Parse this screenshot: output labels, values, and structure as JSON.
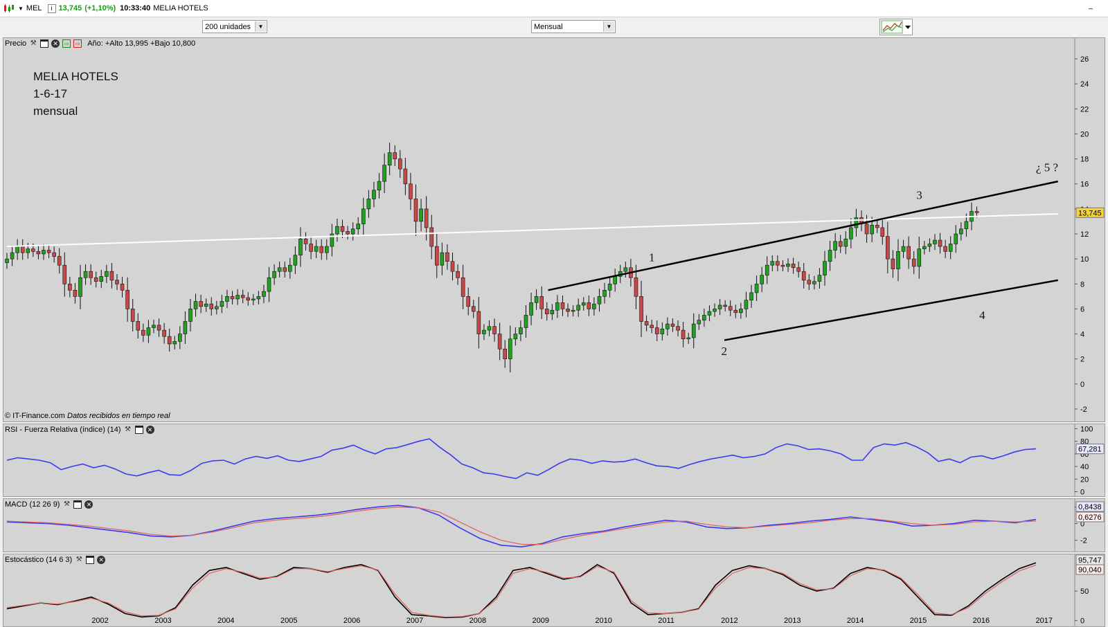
{
  "titlebar": {
    "symbol": "MEL",
    "price": "13,745",
    "change": "(+1,10%)",
    "time": "10:33:40",
    "name": "MELIA HOTELS",
    "minimize": "_"
  },
  "toolbar": {
    "units_value": "200 unidades",
    "period_value": "Mensual"
  },
  "price_panel": {
    "label": "Precio",
    "year_info": "Año: +Alto 13,995 +Bajo 10,800",
    "annotation": [
      "MELIA HOTELS",
      "1-6-17",
      "mensual"
    ],
    "copyright": "© IT-Finance.com",
    "realtime": "Datos recibidos en tiempo real",
    "last_price_badge": "13,745",
    "wave_labels": [
      "1",
      "2",
      "3",
      "4",
      "¿ 5 ?"
    ]
  },
  "rsi_panel": {
    "label": "RSI - Fuerza Relativa (índice) (14)",
    "value_badge": "67,281"
  },
  "macd_panel": {
    "label": "MACD (12 26 9)",
    "value_badge_1": "0,8438",
    "value_badge_2": "0,6276"
  },
  "stoch_panel": {
    "label": "Estocástico (14 6 3)",
    "value_badge_1": "95,747",
    "value_badge_2": "90,040"
  },
  "colors": {
    "up": "#22a022",
    "down": "#c84848",
    "rsi": "#3a3aee",
    "macd": "#3a3aee",
    "signal": "#e06060"
  },
  "chart_data": [
    {
      "type": "candlestick",
      "title": "MELIA HOTELS",
      "x_ticks": [
        "2002",
        "2003",
        "2004",
        "2005",
        "2006",
        "2007",
        "2008",
        "2009",
        "2010",
        "2011",
        "2012",
        "2013",
        "2014",
        "2015",
        "2016",
        "2017"
      ],
      "y_ticks": [
        -2,
        0,
        2,
        4,
        6,
        8,
        10,
        12,
        14,
        16,
        18,
        20,
        22,
        24,
        26
      ],
      "ylim": [
        -3,
        27
      ],
      "start": 2001.0,
      "step": 0.0833,
      "close": [
        10.0,
        10.5,
        11.0,
        10.5,
        10.8,
        10.6,
        10.4,
        10.7,
        10.5,
        10.2,
        9.5,
        8.0,
        7.5,
        7.0,
        8.5,
        9.0,
        8.5,
        8.2,
        8.6,
        9.0,
        8.3,
        8.0,
        7.5,
        6.0,
        5.0,
        4.3,
        3.9,
        4.5,
        4.7,
        4.3,
        3.8,
        3.2,
        3.4,
        4.0,
        5.0,
        6.0,
        6.6,
        6.2,
        6.4,
        6.0,
        6.2,
        6.6,
        7.0,
        6.8,
        7.1,
        6.9,
        6.7,
        6.8,
        7.0,
        7.4,
        8.5,
        9.0,
        9.3,
        9.0,
        9.5,
        10.3,
        11.6,
        11.2,
        10.6,
        11.0,
        10.5,
        11.0,
        12.0,
        12.6,
        12.2,
        12.0,
        12.4,
        12.8,
        14.0,
        14.8,
        15.5,
        16.2,
        17.5,
        18.5,
        18.0,
        17.2,
        16.0,
        14.8,
        13.0,
        14.0,
        12.5,
        11.0,
        9.5,
        10.5,
        9.8,
        9.0,
        8.5,
        7.0,
        6.2,
        5.8,
        4.0,
        4.3,
        4.6,
        4.0,
        2.8,
        2.0,
        3.6,
        4.0,
        4.5,
        5.5,
        6.5,
        7.0,
        6.0,
        5.6,
        5.9,
        6.5,
        6.0,
        5.8,
        5.9,
        6.3,
        6.5,
        6.0,
        6.4,
        7.0,
        7.5,
        8.0,
        8.6,
        9.0,
        9.3,
        8.5,
        7.0,
        5.0,
        4.7,
        4.5,
        4.0,
        4.4,
        4.8,
        4.6,
        4.3,
        3.6,
        3.7,
        4.8,
        5.1,
        5.5,
        5.8,
        6.0,
        6.3,
        6.2,
        5.9,
        5.7,
        6.0,
        6.7,
        7.3,
        8.0,
        8.7,
        9.5,
        9.8,
        9.5,
        9.4,
        9.6,
        9.3,
        9.0,
        8.3,
        8.0,
        8.2,
        8.7,
        9.8,
        10.7,
        11.4,
        11.0,
        11.6,
        12.5,
        13.3,
        12.8,
        12.0,
        12.7,
        12.5,
        11.8,
        10.0,
        9.2,
        10.6,
        11.0,
        10.0,
        9.4,
        10.8,
        11.0,
        11.2,
        11.5,
        11.0,
        10.6,
        11.2,
        12.0,
        12.4,
        13.0,
        13.8,
        13.7
      ],
      "channel_upper": [
        [
          2009.6,
          7.5
        ],
        [
          2017.7,
          16.2
        ]
      ],
      "channel_lower": [
        [
          2012.4,
          3.5
        ],
        [
          2017.7,
          8.3
        ]
      ],
      "horizontal_trend": [
        [
          2001.0,
          11.0
        ],
        [
          2017.7,
          13.6
        ]
      ]
    },
    {
      "type": "line",
      "title": "RSI - Fuerza Relativa (índice) (14)",
      "y_ticks": [
        0,
        20,
        40,
        60,
        80,
        100
      ],
      "ylim": [
        -5,
        105
      ],
      "series": [
        {
          "values": [
            50,
            54,
            52,
            50,
            46,
            35,
            40,
            44,
            38,
            42,
            36,
            28,
            25,
            30,
            34,
            27,
            26,
            34,
            45,
            49,
            50,
            44,
            52,
            56,
            53,
            57,
            50,
            48,
            52,
            56,
            66,
            69,
            74,
            66,
            60,
            68,
            70,
            75,
            80,
            84,
            70,
            58,
            44,
            38,
            30,
            28,
            24,
            21,
            30,
            26,
            35,
            45,
            52,
            50,
            45,
            49,
            47,
            48,
            52,
            46,
            41,
            40,
            37,
            43,
            48,
            52,
            55,
            58,
            54,
            56,
            60,
            70,
            76,
            73,
            67,
            68,
            65,
            60,
            50,
            50,
            70,
            76,
            74,
            78,
            71,
            62,
            48,
            52,
            46,
            55,
            57,
            52,
            57,
            63,
            67,
            68
          ]
        }
      ]
    },
    {
      "type": "line",
      "title": "MACD (12 26 9)",
      "y_ticks": [
        -2,
        0,
        2
      ],
      "ylim": [
        -3.2,
        2.8
      ],
      "series": [
        {
          "values": [
            0.2,
            0.1,
            0.0,
            -0.2,
            -0.5,
            -0.8,
            -1.1,
            -1.5,
            -1.6,
            -1.4,
            -0.9,
            -0.3,
            0.3,
            0.6,
            0.8,
            1.0,
            1.3,
            1.7,
            2.0,
            2.2,
            1.9,
            1.0,
            -0.5,
            -1.8,
            -2.6,
            -2.8,
            -2.4,
            -1.6,
            -1.2,
            -0.9,
            -0.4,
            0.0,
            0.4,
            0.2,
            -0.4,
            -0.6,
            -0.5,
            -0.2,
            0.0,
            0.3,
            0.5,
            0.8,
            0.5,
            0.2,
            -0.3,
            -0.2,
            0.0,
            0.4,
            0.3,
            0.1,
            0.5
          ]
        },
        {
          "values": [
            0.3,
            0.2,
            0.1,
            -0.1,
            -0.3,
            -0.6,
            -0.9,
            -1.3,
            -1.5,
            -1.4,
            -1.0,
            -0.5,
            0.1,
            0.4,
            0.6,
            0.8,
            1.1,
            1.5,
            1.8,
            2.0,
            1.9,
            1.4,
            0.2,
            -1.0,
            -2.0,
            -2.5,
            -2.5,
            -1.9,
            -1.4,
            -1.0,
            -0.6,
            -0.2,
            0.2,
            0.3,
            -0.1,
            -0.4,
            -0.5,
            -0.3,
            -0.1,
            0.1,
            0.4,
            0.6,
            0.6,
            0.3,
            0.0,
            -0.2,
            -0.1,
            0.2,
            0.3,
            0.2,
            0.3
          ]
        }
      ]
    },
    {
      "type": "line",
      "title": "Estocástico (14 6 3)",
      "y_ticks": [
        0,
        50
      ],
      "ylim": [
        -5,
        110
      ],
      "series": [
        {
          "values": [
            20,
            25,
            30,
            27,
            33,
            40,
            28,
            12,
            6,
            8,
            22,
            60,
            85,
            90,
            80,
            70,
            75,
            90,
            88,
            82,
            90,
            95,
            85,
            40,
            10,
            8,
            5,
            6,
            12,
            40,
            85,
            90,
            80,
            70,
            75,
            95,
            80,
            30,
            10,
            12,
            14,
            20,
            60,
            85,
            93,
            88,
            78,
            60,
            50,
            55,
            80,
            90,
            85,
            70,
            40,
            10,
            9,
            25,
            50,
            70,
            88,
            98
          ]
        },
        {
          "values": [
            22,
            26,
            30,
            28,
            32,
            38,
            30,
            15,
            8,
            9,
            20,
            55,
            80,
            88,
            82,
            72,
            74,
            88,
            88,
            83,
            88,
            93,
            86,
            45,
            14,
            9,
            6,
            7,
            12,
            36,
            80,
            88,
            82,
            72,
            74,
            92,
            82,
            34,
            13,
            12,
            14,
            19,
            55,
            80,
            90,
            88,
            80,
            63,
            52,
            54,
            76,
            88,
            86,
            72,
            44,
            13,
            10,
            22,
            46,
            66,
            84,
            94
          ]
        }
      ]
    }
  ]
}
